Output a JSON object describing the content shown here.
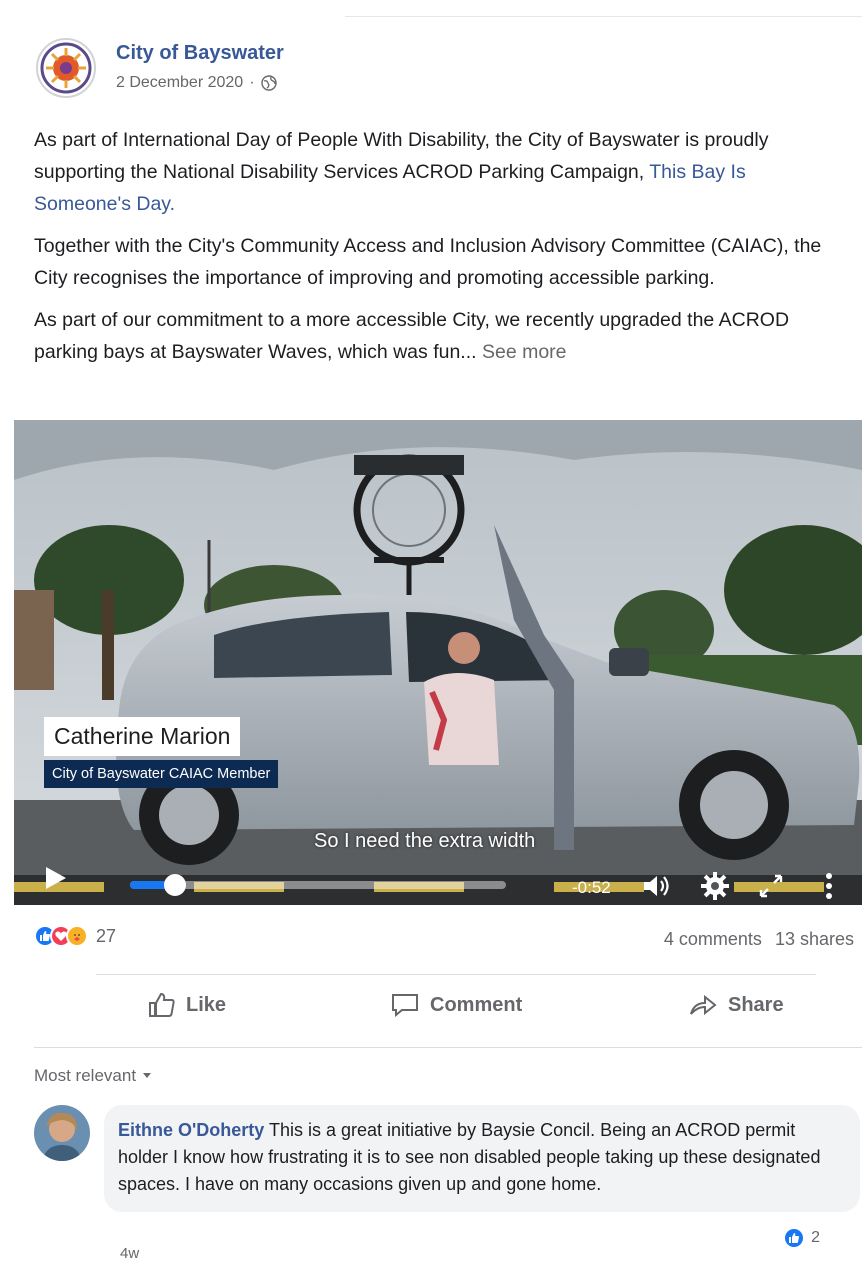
{
  "post": {
    "page_name": "City of Bayswater",
    "date": "2 December 2020",
    "date_separator": "·",
    "paragraph1_a": "As part of International Day of People With Disability, the City of Bayswater is proudly supporting the National Disability Services ACROD Parking Campaign, ",
    "paragraph1_link": "This Bay Is Someone's Day.",
    "paragraph2": "Together with the City's Community Access and Inclusion Advisory Committee (CAIAC), the City recognises the importance of improving and promoting accessible parking.",
    "paragraph3": "As part of our commitment to a more accessible City, we recently upgraded the ACROD parking bays at Bayswater Waves, which was fun...",
    "see_more": "See more"
  },
  "video": {
    "lower_third_name": "Catherine Marion",
    "lower_third_role": "City of Bayswater CAIAC Member",
    "caption": "So I need the extra width",
    "time_remaining": "-0:52",
    "progress_fraction": 0.12
  },
  "stats": {
    "reaction_count": "27",
    "comments": "4 comments",
    "shares": "13 shares"
  },
  "actions": {
    "like": "Like",
    "comment": "Comment",
    "share": "Share"
  },
  "comments": {
    "sort_label": "Most relevant",
    "items": [
      {
        "author": "Eithne O'Doherty",
        "text": "This is a great initiative by Baysie Concil. Being an ACROD permit holder I know how frustrating it is to see non disabled people taking up these designated spaces. I have on many occasions given up and gone home.",
        "time": "4w",
        "likes": "2"
      }
    ]
  },
  "colors": {
    "link": "#385898",
    "muted": "#65676b",
    "accent": "#1877f2",
    "lower_third_bg": "#0d2b52"
  },
  "icons": [
    "globe-icon",
    "play-icon",
    "volume-icon",
    "settings-icon",
    "fullscreen-icon",
    "more-icon",
    "like-icon",
    "comment-icon",
    "share-icon",
    "caret-down-icon"
  ]
}
